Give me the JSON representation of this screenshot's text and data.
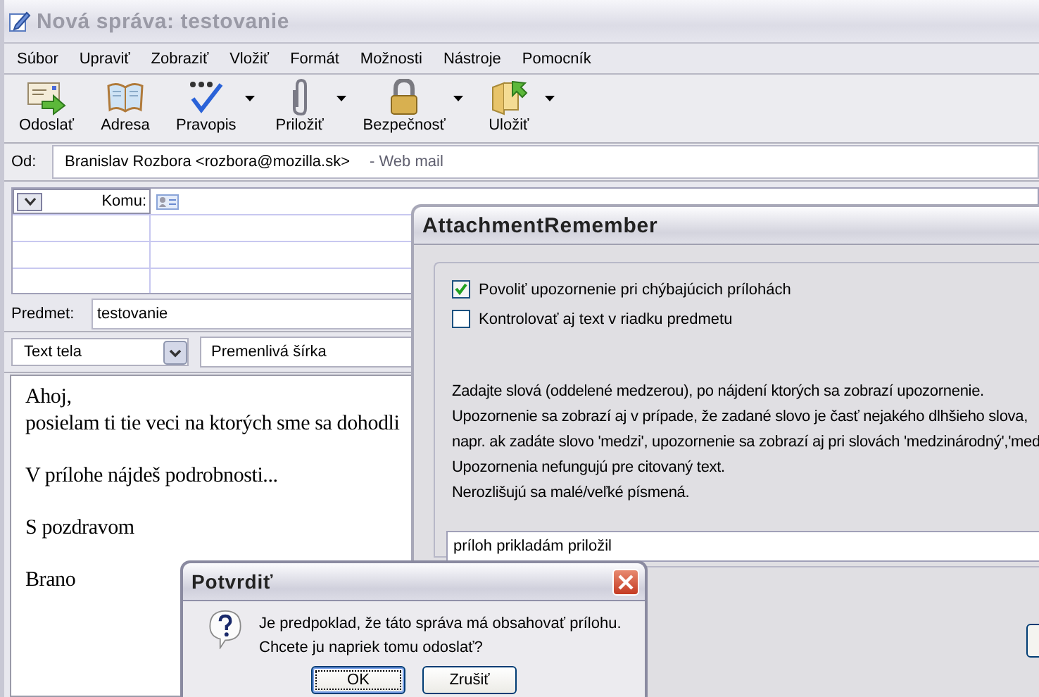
{
  "main_window": {
    "title": "Nová správa: testovanie",
    "menu": [
      {
        "label": "Súbor"
      },
      {
        "label": "Upraviť"
      },
      {
        "label": "Zobraziť"
      },
      {
        "label": "Vložiť"
      },
      {
        "label": "Formát"
      },
      {
        "label": "Možnosti"
      },
      {
        "label": "Nástroje"
      },
      {
        "label": "Pomocník"
      }
    ],
    "toolbar": [
      {
        "kind": "send",
        "label": "Odoslať",
        "has_menu": false
      },
      {
        "kind": "address",
        "label": "Adresa",
        "has_menu": false
      },
      {
        "kind": "spell",
        "label": "Pravopis",
        "has_menu": true
      },
      {
        "kind": "attach",
        "label": "Priložiť",
        "has_menu": true
      },
      {
        "kind": "security",
        "label": "Bezpečnosť",
        "has_menu": true
      },
      {
        "kind": "save",
        "label": "Uložiť",
        "has_menu": true
      }
    ],
    "from": {
      "label": "Od:",
      "value": "Branislav Rozbora <rozbora@mozilla.sk>",
      "account": "- Web mail"
    },
    "recipients": {
      "type_label": "Komu:"
    },
    "subject": {
      "label": "Predmet:",
      "value": "testovanie"
    },
    "format_bar": {
      "paragraph_style": "Text tela",
      "font": "Premenlivá šírka"
    },
    "body": [
      {
        "lines": [
          "Ahoj,",
          "posielam ti tie veci na ktorých sme sa dohodli"
        ]
      },
      {
        "lines": [
          "V prílohe nájdeš podrobnosti..."
        ]
      },
      {
        "lines": [
          "S pozdravom"
        ]
      },
      {
        "lines": [
          "Brano"
        ]
      }
    ]
  },
  "attachment_dialog": {
    "title": "AttachmentRemember",
    "options": [
      {
        "label": "Povoliť upozornenie pri chýbajúcich prílohách",
        "checked": true
      },
      {
        "label": "Kontrolovať aj text v riadku predmetu",
        "checked": false
      }
    ],
    "description": [
      "Zadajte slová (oddelené medzerou), po nájdení ktorých sa zobrazí upozornenie.",
      "Upozornenie sa zobrazí aj v prípade, že zadané slovo je časť nejakého dlhšieho slova,",
      "napr. ak zadáte slovo 'medzi', upozornenie sa zobrazí aj pri slovách 'medzinárodný','med",
      "Upozornenia nefungujú pre citovaný text.",
      "Nerozlišujú sa malé/veľké písmená."
    ],
    "keywords": "príloh prikladám priložil"
  },
  "confirm_dialog": {
    "title": "Potvrdiť",
    "message": [
      "Je predpoklad, že táto správa má obsahovať prílohu.",
      "Chcete ju napriek tomu odoslať?"
    ],
    "buttons": [
      {
        "label": "OK",
        "focused": true
      },
      {
        "label": "Zrušiť",
        "focused": false
      }
    ]
  }
}
